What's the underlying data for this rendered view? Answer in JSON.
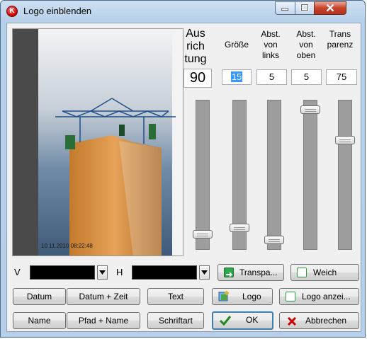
{
  "window": {
    "title": "Logo einblenden",
    "app_icon": "app-logo-icon"
  },
  "preview": {
    "timestamp": "10.11.2010 08:22:48"
  },
  "columns": [
    {
      "header": [
        "Aus",
        "rich",
        "tung"
      ],
      "value": "90",
      "level": 0.06
    },
    {
      "header": [
        "Größe"
      ],
      "value": "15",
      "level": 0.11
    },
    {
      "header": [
        "Abst.",
        "von",
        "links"
      ],
      "value": "5",
      "level": 0.02
    },
    {
      "header": [
        "Abst.",
        "von",
        "oben"
      ],
      "value": "5",
      "level": 0.97
    },
    {
      "header": [
        "Trans",
        "parenz"
      ],
      "value": "75",
      "level": 0.75
    }
  ],
  "row_v": {
    "label": "V",
    "color": "#000000"
  },
  "row_h": {
    "label": "H",
    "color": "#000000"
  },
  "buttons": {
    "transparent": "Transpa...",
    "weich": "Weich",
    "datum": "Datum",
    "datum_zeit": "Datum + Zeit",
    "text": "Text",
    "logo": "Logo",
    "logo_anzeigen": "Logo anzei...",
    "name": "Name",
    "pfad_name": "Pfad + Name",
    "schriftart": "Schriftart",
    "ok": "OK",
    "abbrechen": "Abbrechen"
  },
  "colors": {
    "accent": "#3399ff",
    "ok_check": "#1e8a1e",
    "cancel_x": "#d00000",
    "frame": "#b7cfe8"
  }
}
